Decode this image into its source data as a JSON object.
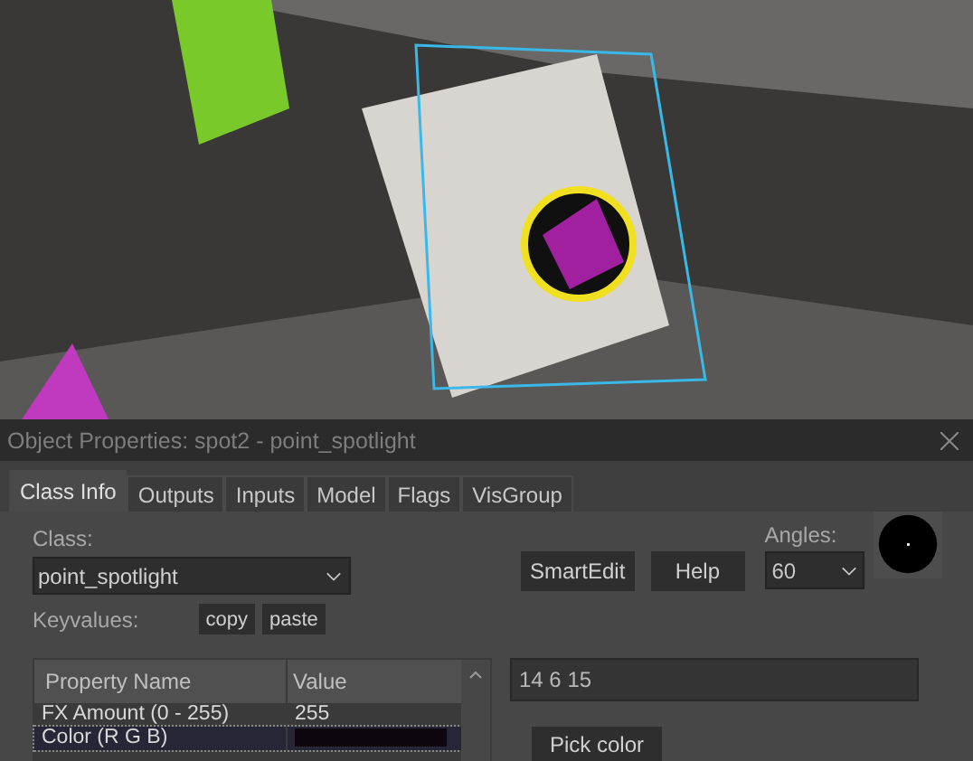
{
  "dialog": {
    "title": "Object Properties: spot2 - point_spotlight"
  },
  "tabs": [
    {
      "label": "Class Info",
      "selected": true
    },
    {
      "label": "Outputs",
      "selected": false
    },
    {
      "label": "Inputs",
      "selected": false
    },
    {
      "label": "Model",
      "selected": false
    },
    {
      "label": "Flags",
      "selected": false
    },
    {
      "label": "VisGroup",
      "selected": false
    }
  ],
  "class": {
    "label": "Class:",
    "value": "point_spotlight"
  },
  "keyvalues": {
    "label": "Keyvalues:",
    "buttons": [
      "copy",
      "paste"
    ]
  },
  "buttons": [
    "SmartEdit",
    "Help"
  ],
  "angles": {
    "label": "Angles:",
    "value": "60"
  },
  "table": {
    "columns": [
      "Property Name",
      "Value"
    ],
    "rows": [
      {
        "name": "FX Amount (0 - 255)",
        "kind": "text",
        "value": "255",
        "selected": false
      },
      {
        "name": "Color (R G B)",
        "kind": "color",
        "color": "#0e060f",
        "selected": true
      }
    ]
  },
  "value_field": {
    "value": "14 6 15"
  },
  "pick_button": "Pick color"
}
